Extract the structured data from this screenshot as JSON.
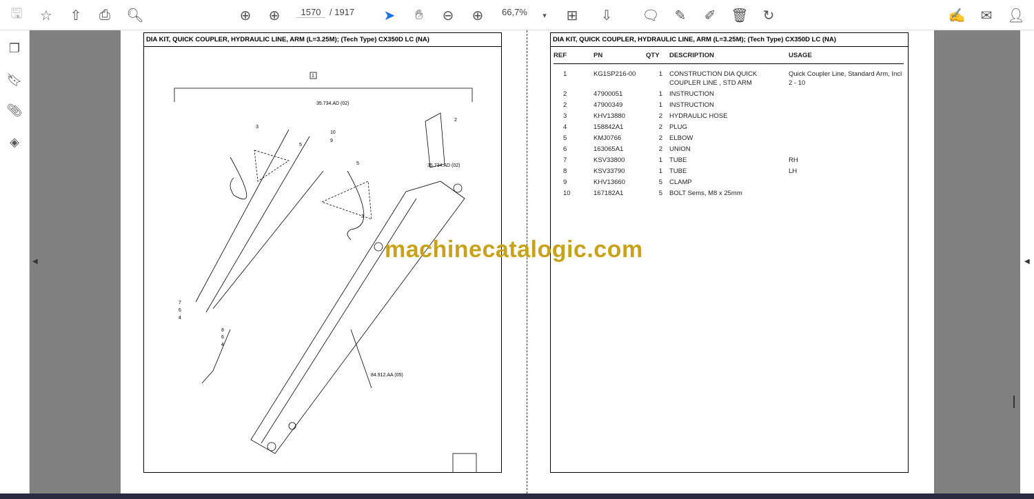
{
  "toolbar": {
    "page_current": "1570",
    "page_total": "/ 1917",
    "zoom": "66,7%"
  },
  "left_page": {
    "title": "DIA KIT, QUICK COUPLER, HYDRAULIC LINE, ARM (L=3.25M); (Tech Type) CX350D LC (NA)",
    "callouts": {
      "c1": "1",
      "c2": "2",
      "c3a": "3",
      "c3b": "3",
      "c5a": "5",
      "c5b": "5",
      "c9": "9",
      "c10": "10",
      "c7": "7",
      "c6a": "6",
      "c4a": "4",
      "c8": "8",
      "c6b": "6",
      "c4b": "4",
      "ref1": "35.734.AD (02)",
      "ref2": "35.734.AD (02)",
      "ref3": "84.912.AA (05)"
    }
  },
  "right_page": {
    "title": "DIA KIT, QUICK COUPLER, HYDRAULIC LINE, ARM (L=3.25M); (Tech Type) CX350D LC (NA)",
    "columns": [
      "REF",
      "PN",
      "QTY",
      "DESCRIPTION",
      "USAGE"
    ],
    "rows": [
      [
        "1",
        "KG1SP216-00",
        "1",
        "CONSTRUCTION DIA QUICK COUPLER LINE , STD ARM",
        "Quick Coupler Line, Standard Arm, Incl 2 - 10"
      ],
      [
        "2",
        "47900051",
        "1",
        "INSTRUCTION",
        ""
      ],
      [
        "2",
        "47900349",
        "1",
        "INSTRUCTION",
        ""
      ],
      [
        "3",
        "KHV13880",
        "2",
        "HYDRAULIC HOSE",
        ""
      ],
      [
        "4",
        "158842A1",
        "2",
        "PLUG",
        ""
      ],
      [
        "5",
        "KMJ0766",
        "2",
        "ELBOW",
        ""
      ],
      [
        "6",
        "163065A1",
        "2",
        "UNION",
        ""
      ],
      [
        "7",
        "KSV33800",
        "1",
        "TUBE",
        "RH"
      ],
      [
        "8",
        "KSV33790",
        "1",
        "TUBE",
        "LH"
      ],
      [
        "9",
        "KHV13660",
        "5",
        "CLAMP",
        ""
      ],
      [
        "10",
        "167182A1",
        "5",
        "BOLT Sems, M8 x 25mm",
        ""
      ]
    ]
  },
  "watermark": "machinecatalogic.com"
}
